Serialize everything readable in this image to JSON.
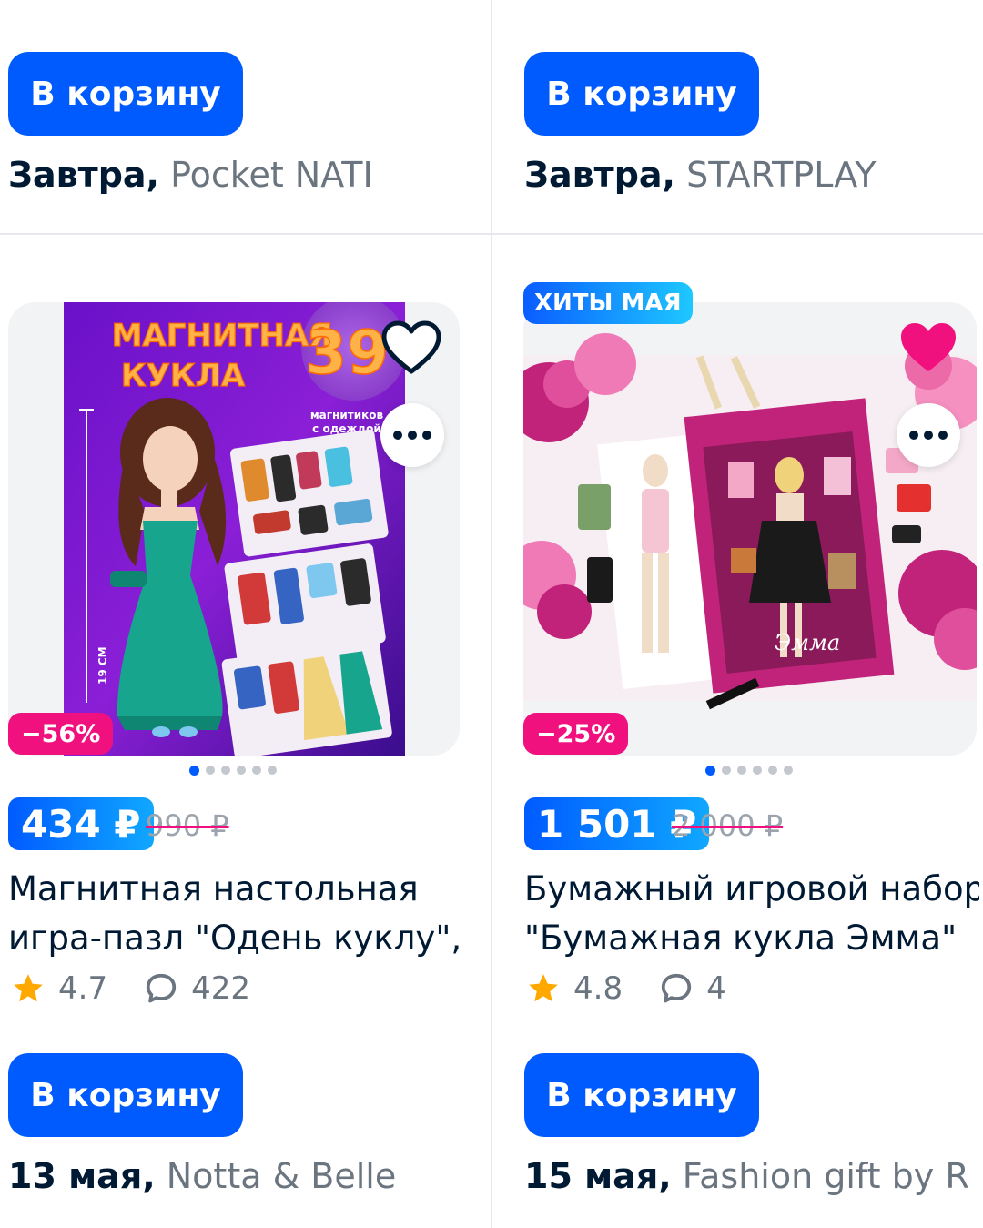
{
  "top_row": {
    "left": {
      "button_label": "В корзину",
      "delivery_date": "Завтра,",
      "seller": "Pocket NATI"
    },
    "right": {
      "button_label": "В корзину",
      "delivery_date": "Завтра,",
      "seller": "STARTPLAY"
    }
  },
  "products": [
    {
      "discount": "−56%",
      "price": "434 ₽",
      "old_price": "990 ₽",
      "title_line1": "Магнитная настольная",
      "title_line2": "игра-пазл \"Одень куклу\",...",
      "rating": "4.7",
      "reviews": "422",
      "button_label": "В корзину",
      "delivery_date": "13 мая,",
      "seller": "Notta & Belle",
      "image_text": {
        "headline1": "МАГНИТНАЯ",
        "headline2": "КУКЛА",
        "count": "39",
        "count_caption1": "магнитиков",
        "count_caption2": "с одеждой",
        "height_label": "19 СМ"
      },
      "favorited": false,
      "gallery_count": 6,
      "gallery_active": 0
    },
    {
      "badge": "ХИТЫ МАЯ",
      "discount": "−25%",
      "price": "1 501 ₽",
      "old_price": "2 000 ₽",
      "title_line1": "Бумажный игровой набор",
      "title_line2": "\"Бумажная кукла Эмма\"",
      "rating": "4.8",
      "reviews": "4",
      "button_label": "В корзину",
      "delivery_date": "15 мая,",
      "seller": "Fashion gift by Ri...",
      "image_text": {
        "box_script": "Эмма"
      },
      "favorited": true,
      "gallery_count": 6,
      "gallery_active": 0
    }
  ],
  "icons": {
    "favorite_outline": "heart-outline-icon",
    "favorite_filled": "heart-filled-icon",
    "more": "more-dots-icon",
    "rating": "star-icon",
    "reviews": "comment-bubble-icon"
  },
  "colors": {
    "accent": "#005bff",
    "discount": "#f1117e",
    "favorite": "#f1117e",
    "star": "#ffa800"
  }
}
